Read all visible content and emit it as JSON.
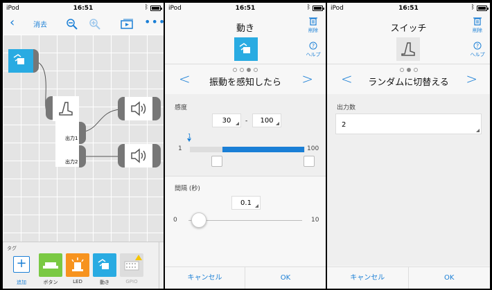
{
  "status": {
    "carrier": "iPod",
    "time": "16:51"
  },
  "panel1": {
    "nav": {
      "delete_label": "消去"
    },
    "canvas": {
      "out1_label": "出力1",
      "out2_label": "出力2"
    },
    "tray": {
      "tag_label": "タグ",
      "items": [
        {
          "label": "追加",
          "icon": "add-icon"
        },
        {
          "label": "ボタン",
          "icon": "button-icon",
          "color": "#7ac943"
        },
        {
          "label": "LED",
          "icon": "led-icon",
          "color": "#f7931e"
        },
        {
          "label": "動き",
          "icon": "motion-icon",
          "color": "#29abe2"
        },
        {
          "label": "GPIO",
          "icon": "gpio-icon",
          "color": "#dddddd"
        }
      ]
    }
  },
  "panel2": {
    "title": "動き",
    "trash_label": "削除",
    "help_label": "ヘルプ",
    "heading": "振動を感知したら",
    "sensitivity": {
      "label": "感度",
      "min_value": "30",
      "dash": "-",
      "max_value": "100",
      "marker": "1",
      "scale_min": "1",
      "scale_max": "100"
    },
    "interval": {
      "label": "間隔 (秒)",
      "value": "0.1",
      "scale_min": "0",
      "scale_max": "10"
    },
    "cancel_label": "キャンセル",
    "ok_label": "OK"
  },
  "panel3": {
    "title": "スイッチ",
    "trash_label": "削除",
    "help_label": "ヘルプ",
    "heading": "ランダムに切替える",
    "output_label": "出力数",
    "output_value": "2",
    "cancel_label": "キャンセル",
    "ok_label": "OK"
  },
  "colors": {
    "accent": "#1a7fd6",
    "motion": "#29abe2"
  }
}
